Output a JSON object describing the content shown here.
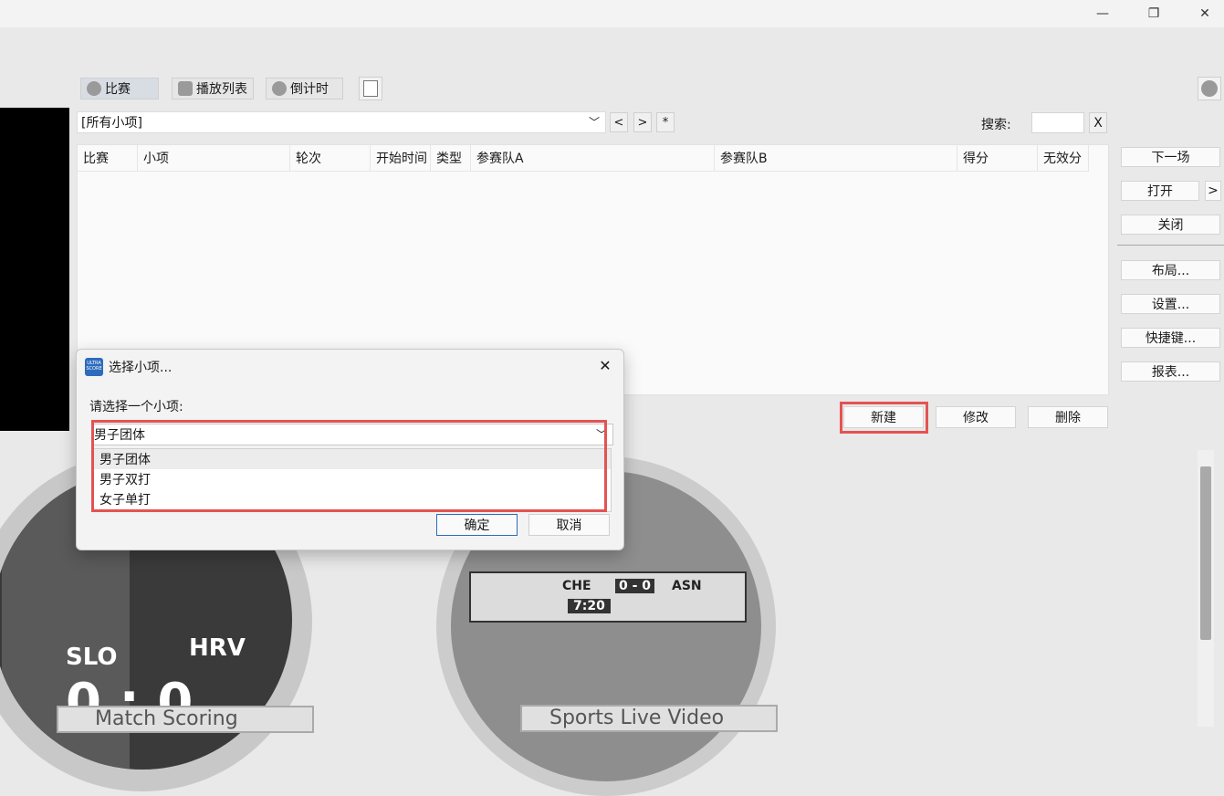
{
  "window": {
    "minimize": "—",
    "restore": "❐",
    "close": "✕"
  },
  "toolbar": {
    "tabs": [
      {
        "label": "比赛",
        "icon": "rocket-icon"
      },
      {
        "label": "播放列表",
        "icon": "playlist-icon"
      },
      {
        "label": "倒计时",
        "icon": "timer-icon"
      }
    ],
    "notes_icon": "notes-icon",
    "account_icon": "user-icon"
  },
  "filter": {
    "selected": "[所有小项]",
    "prev": "<",
    "next": ">",
    "star": "*",
    "search_label": "搜索:",
    "search_value": "",
    "clear": "X"
  },
  "table": {
    "columns": [
      "比赛",
      "小项",
      "轮次",
      "开始时间",
      "类型",
      "参赛队A",
      "参赛队B",
      "得分",
      "无效分"
    ]
  },
  "right_panel": {
    "next_match": "下一场",
    "open": "打开",
    "open_more": ">",
    "close": "关闭",
    "layout": "布局...",
    "settings": "设置...",
    "shortcuts": "快捷键...",
    "reports": "报表..."
  },
  "actions": {
    "new": "新建",
    "edit": "修改",
    "delete": "删除"
  },
  "preview": {
    "scoreboard": {
      "team_a": "SLO",
      "team_b": "HRV",
      "score": "0 : 0",
      "caption": "Match Scoring"
    },
    "video": {
      "team_a": "CHE",
      "score": "0 - 0",
      "team_b": "ASN",
      "clock": "7:20",
      "caption": "Sports Live Video"
    }
  },
  "dialog": {
    "app_icon_text": "ULTRA SCORE",
    "title": "选择小项...",
    "prompt": "请选择一个小项:",
    "selected": "男子团体",
    "options": [
      "男子团体",
      "男子双打",
      "女子单打"
    ],
    "ok": "确定",
    "cancel": "取消"
  },
  "colors": {
    "highlight": "#e45353",
    "accent": "#2d6bbd"
  }
}
